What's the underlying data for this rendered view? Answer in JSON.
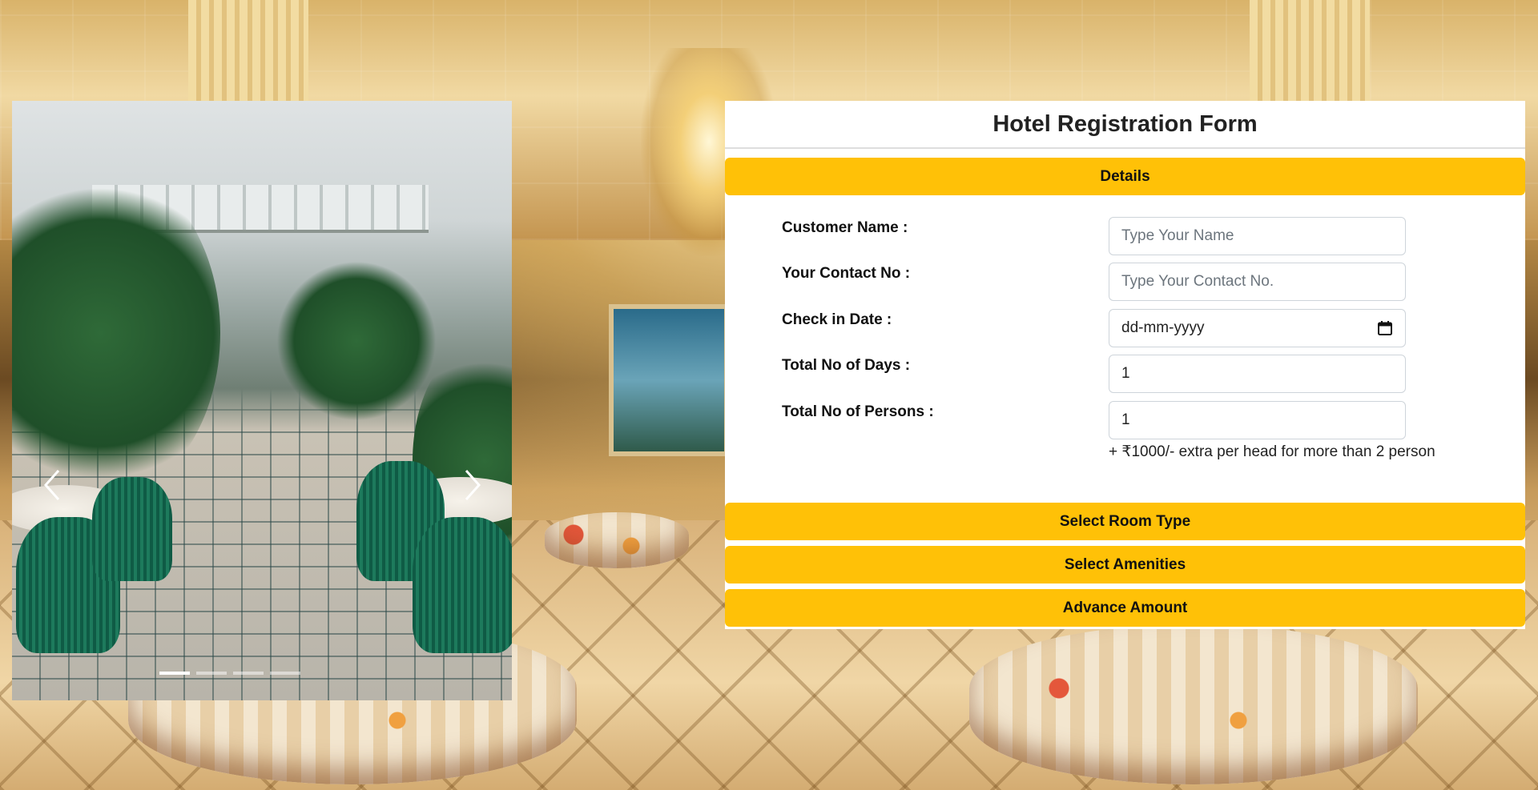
{
  "form": {
    "title": "Hotel Registration Form",
    "sections": {
      "details": "Details",
      "room_type": "Select Room Type",
      "amenities": "Select Amenities",
      "advance": "Advance Amount"
    },
    "fields": {
      "customer_name": {
        "label": "Customer Name :",
        "placeholder": "Type Your Name",
        "value": ""
      },
      "contact_no": {
        "label": "Your Contact No :",
        "placeholder": "Type Your Contact No.",
        "value": ""
      },
      "check_in": {
        "label": "Check in Date :",
        "value": "dd-mm-yyyy"
      },
      "total_days": {
        "label": "Total No of Days :",
        "value": "1"
      },
      "total_persons": {
        "label": "Total No of Persons :",
        "value": "1"
      }
    },
    "note": "+ ₹1000/- extra per head for more than 2 person"
  },
  "carousel": {
    "slides": 4,
    "active_slide": 1,
    "prev_icon": "chevron-left-icon",
    "next_icon": "chevron-right-icon"
  },
  "colors": {
    "accent": "#ffc107",
    "panel": "#ffffff"
  }
}
